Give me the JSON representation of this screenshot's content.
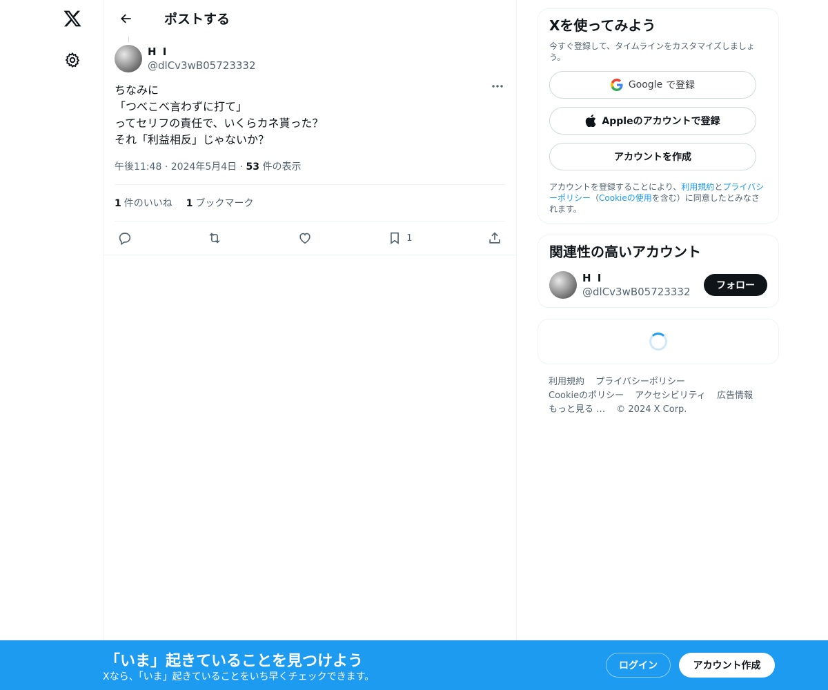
{
  "nav": {
    "logo_icon": "x-logo-icon",
    "settings_icon": "gear-icon"
  },
  "header": {
    "title": "ポストする"
  },
  "post": {
    "author_name": "H I",
    "author_handle": "@dlCv3wB05723332",
    "lines": [
      "ちなみに",
      "「つべこべ言わずに打て」",
      "ってセリフの責任で、いくらカネ貰った？",
      "それ「利益相反」じゃないか？"
    ],
    "time": "午後11:48",
    "date": "2024年5月4日",
    "views_count": "53",
    "views_label": "件の表示",
    "likes_count": "1",
    "likes_label": "件のいいね",
    "bookmarks_count": "1",
    "bookmarks_label": "ブックマーク",
    "bookmark_action_count": "1"
  },
  "signup_card": {
    "title": "Xを使ってみよう",
    "subtitle": "今すぐ登録して、タイムラインをカスタマイズしましょう。",
    "google_brand": "Google",
    "google_suffix": "で登録",
    "apple_label": "Appleのアカウントで登録",
    "create_label": "アカウントを作成",
    "legal_prefix": "アカウントを登録することにより、",
    "terms_link": "利用規約",
    "legal_and": "と",
    "privacy_link": "プライバシーポリシー",
    "legal_paren_open": "（",
    "cookie_link": "Cookieの使用",
    "legal_suffix": "を含む）に同意したとみなされます。"
  },
  "related": {
    "title": "関連性の高いアカウント",
    "account_name": "H I",
    "account_handle": "@dlCv3wB05723332",
    "follow_label": "フォロー"
  },
  "footer": {
    "links": [
      "利用規約",
      "プライバシーポリシー",
      "Cookieのポリシー",
      "アクセシビリティ",
      "広告情報",
      "もっと見る …"
    ],
    "copyright": "© 2024 X Corp."
  },
  "banner": {
    "title": "「いま」起きていることを見つけよう",
    "subtitle": "Xなら、「いま」起きていることをいち早くチェックできます。",
    "login_label": "ログイン",
    "signup_label": "アカウント作成"
  },
  "colors": {
    "accent": "#1d9bf0",
    "text": "#0f1419",
    "muted": "#536471"
  }
}
